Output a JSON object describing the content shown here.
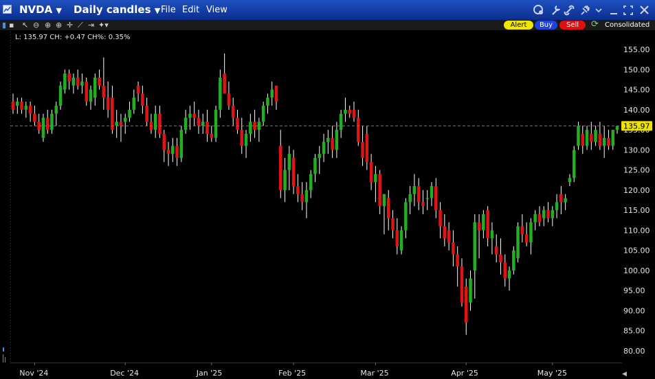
{
  "window": {
    "symbol": "NVDA",
    "chart_type": "Daily candles",
    "menus": [
      "File",
      "Edit",
      "View"
    ]
  },
  "toolbar": {
    "alert_label": "Alert",
    "buy_label": "Buy",
    "sell_label": "Sell",
    "route_label": "Consolidated",
    "colors": {
      "alert": "#f2e600",
      "buy": "#2244dd",
      "sell": "#e01010",
      "up": "#22b022",
      "down": "#e01414"
    }
  },
  "legend": {
    "text": "L: 135.97 CH: +0.47 CH%: 0.35%"
  },
  "chart_data": {
    "type": "candlestick",
    "title": "",
    "last_price": 135.97,
    "last_price_label": "135.97",
    "ylim": [
      77,
      158
    ],
    "y_ticks": [
      "80.00",
      "85.00",
      "90.00",
      "95.00",
      "100.00",
      "105.00",
      "110.00",
      "115.00",
      "120.00",
      "125.00",
      "130.00",
      "135.00",
      "140.00",
      "145.00",
      "150.00",
      "155.00"
    ],
    "x_labels": [
      {
        "label": "Nov '24",
        "index": 5
      },
      {
        "label": "Dec '24",
        "index": 26
      },
      {
        "label": "Jan '25",
        "index": 46
      },
      {
        "label": "Feb '25",
        "index": 65
      },
      {
        "label": "Mar '25",
        "index": 84
      },
      {
        "label": "Apr '25",
        "index": 105
      },
      {
        "label": "May '25",
        "index": 125
      }
    ],
    "candles": [
      {
        "o": 142,
        "h": 144,
        "l": 139,
        "c": 140
      },
      {
        "o": 141,
        "h": 143,
        "l": 139,
        "c": 142
      },
      {
        "o": 142,
        "h": 143,
        "l": 139,
        "c": 140
      },
      {
        "o": 140,
        "h": 142,
        "l": 138,
        "c": 141
      },
      {
        "o": 141,
        "h": 142,
        "l": 137,
        "c": 139
      },
      {
        "o": 139,
        "h": 141,
        "l": 136,
        "c": 137
      },
      {
        "o": 137,
        "h": 139,
        "l": 134,
        "c": 135
      },
      {
        "o": 133,
        "h": 139,
        "l": 132,
        "c": 138
      },
      {
        "o": 138,
        "h": 140,
        "l": 134,
        "c": 135
      },
      {
        "o": 135,
        "h": 140,
        "l": 134,
        "c": 139
      },
      {
        "o": 139,
        "h": 142,
        "l": 136,
        "c": 141
      },
      {
        "o": 141,
        "h": 147,
        "l": 140,
        "c": 146
      },
      {
        "o": 145,
        "h": 150,
        "l": 144,
        "c": 149
      },
      {
        "o": 149,
        "h": 150,
        "l": 145,
        "c": 147
      },
      {
        "o": 146,
        "h": 149,
        "l": 144,
        "c": 148
      },
      {
        "o": 148,
        "h": 150,
        "l": 145,
        "c": 146
      },
      {
        "o": 146,
        "h": 149,
        "l": 144,
        "c": 147
      },
      {
        "o": 147,
        "h": 148,
        "l": 141,
        "c": 142
      },
      {
        "o": 142,
        "h": 146,
        "l": 140,
        "c": 145
      },
      {
        "o": 143,
        "h": 149,
        "l": 141,
        "c": 148
      },
      {
        "o": 148,
        "h": 150,
        "l": 145,
        "c": 146
      },
      {
        "o": 146,
        "h": 153,
        "l": 140,
        "c": 143
      },
      {
        "o": 143,
        "h": 147,
        "l": 138,
        "c": 140
      },
      {
        "o": 143,
        "h": 146,
        "l": 134,
        "c": 135
      },
      {
        "o": 136,
        "h": 140,
        "l": 133,
        "c": 137
      },
      {
        "o": 137,
        "h": 139,
        "l": 132,
        "c": 136
      },
      {
        "o": 137,
        "h": 139,
        "l": 134,
        "c": 138
      },
      {
        "o": 138,
        "h": 142,
        "l": 137,
        "c": 140
      },
      {
        "o": 140,
        "h": 145,
        "l": 139,
        "c": 143
      },
      {
        "o": 146,
        "h": 147,
        "l": 142,
        "c": 144
      },
      {
        "o": 144,
        "h": 146,
        "l": 139,
        "c": 141
      },
      {
        "o": 141,
        "h": 143,
        "l": 136,
        "c": 137
      },
      {
        "o": 137,
        "h": 139,
        "l": 134,
        "c": 135
      },
      {
        "o": 135,
        "h": 141,
        "l": 133,
        "c": 139
      },
      {
        "o": 139,
        "h": 141,
        "l": 133,
        "c": 134
      },
      {
        "o": 134,
        "h": 135,
        "l": 127,
        "c": 130
      },
      {
        "o": 130,
        "h": 132,
        "l": 126,
        "c": 129
      },
      {
        "o": 129,
        "h": 133,
        "l": 127,
        "c": 131
      },
      {
        "o": 131,
        "h": 133,
        "l": 126,
        "c": 128
      },
      {
        "o": 128,
        "h": 136,
        "l": 127,
        "c": 135
      },
      {
        "o": 135,
        "h": 140,
        "l": 134,
        "c": 138
      },
      {
        "o": 138,
        "h": 141,
        "l": 135,
        "c": 139
      },
      {
        "o": 139,
        "h": 142,
        "l": 136,
        "c": 138
      },
      {
        "o": 138,
        "h": 140,
        "l": 134,
        "c": 136
      },
      {
        "o": 136,
        "h": 139,
        "l": 134,
        "c": 137
      },
      {
        "o": 137,
        "h": 140,
        "l": 132,
        "c": 134
      },
      {
        "o": 134,
        "h": 136,
        "l": 132,
        "c": 133
      },
      {
        "o": 133,
        "h": 141,
        "l": 132,
        "c": 140
      },
      {
        "o": 140,
        "h": 150,
        "l": 138,
        "c": 148
      },
      {
        "o": 149,
        "h": 154,
        "l": 144,
        "c": 144
      },
      {
        "o": 144,
        "h": 147,
        "l": 140,
        "c": 141
      },
      {
        "o": 141,
        "h": 143,
        "l": 136,
        "c": 138
      },
      {
        "o": 138,
        "h": 140,
        "l": 134,
        "c": 135
      },
      {
        "o": 135,
        "h": 138,
        "l": 129,
        "c": 131
      },
      {
        "o": 131,
        "h": 135,
        "l": 128,
        "c": 134
      },
      {
        "o": 134,
        "h": 139,
        "l": 132,
        "c": 137
      },
      {
        "o": 137,
        "h": 140,
        "l": 133,
        "c": 135
      },
      {
        "o": 135,
        "h": 138,
        "l": 132,
        "c": 137
      },
      {
        "o": 137,
        "h": 142,
        "l": 136,
        "c": 141
      },
      {
        "o": 141,
        "h": 144,
        "l": 139,
        "c": 143
      },
      {
        "o": 143,
        "h": 147,
        "l": 141,
        "c": 145
      },
      {
        "o": 146,
        "h": 146,
        "l": 140,
        "c": 142
      },
      {
        "o": 131,
        "h": 135,
        "l": 118,
        "c": 120
      },
      {
        "o": 120,
        "h": 128,
        "l": 117,
        "c": 125
      },
      {
        "o": 125,
        "h": 131,
        "l": 120,
        "c": 129
      },
      {
        "o": 128,
        "h": 130,
        "l": 119,
        "c": 121
      },
      {
        "o": 121,
        "h": 124,
        "l": 117,
        "c": 119
      },
      {
        "o": 119,
        "h": 122,
        "l": 115,
        "c": 117
      },
      {
        "o": 117,
        "h": 122,
        "l": 113,
        "c": 120
      },
      {
        "o": 120,
        "h": 125,
        "l": 118,
        "c": 124
      },
      {
        "o": 124,
        "h": 129,
        "l": 122,
        "c": 128
      },
      {
        "o": 128,
        "h": 131,
        "l": 124,
        "c": 129
      },
      {
        "o": 129,
        "h": 134,
        "l": 127,
        "c": 132
      },
      {
        "o": 132,
        "h": 135,
        "l": 129,
        "c": 133
      },
      {
        "o": 133,
        "h": 136,
        "l": 128,
        "c": 130
      },
      {
        "o": 130,
        "h": 137,
        "l": 128,
        "c": 135
      },
      {
        "o": 135,
        "h": 140,
        "l": 133,
        "c": 139
      },
      {
        "o": 139,
        "h": 143,
        "l": 137,
        "c": 140
      },
      {
        "o": 140,
        "h": 141,
        "l": 138,
        "c": 139
      },
      {
        "o": 140,
        "h": 142,
        "l": 137,
        "c": 138
      },
      {
        "o": 138,
        "h": 140,
        "l": 131,
        "c": 132
      },
      {
        "o": 132,
        "h": 136,
        "l": 126,
        "c": 128
      },
      {
        "o": 134,
        "h": 136,
        "l": 125,
        "c": 127
      },
      {
        "o": 127,
        "h": 129,
        "l": 120,
        "c": 122
      },
      {
        "o": 122,
        "h": 126,
        "l": 117,
        "c": 124
      },
      {
        "o": 124,
        "h": 125,
        "l": 114,
        "c": 116
      },
      {
        "o": 116,
        "h": 119,
        "l": 109,
        "c": 119
      },
      {
        "o": 118,
        "h": 120,
        "l": 110,
        "c": 113
      },
      {
        "o": 113,
        "h": 115,
        "l": 108,
        "c": 110
      },
      {
        "o": 110,
        "h": 113,
        "l": 104,
        "c": 106
      },
      {
        "o": 105,
        "h": 111,
        "l": 104,
        "c": 110
      },
      {
        "o": 110,
        "h": 118,
        "l": 108,
        "c": 117
      },
      {
        "o": 117,
        "h": 121,
        "l": 114,
        "c": 119
      },
      {
        "o": 119,
        "h": 124,
        "l": 116,
        "c": 121
      },
      {
        "o": 121,
        "h": 123,
        "l": 115,
        "c": 117
      },
      {
        "o": 117,
        "h": 120,
        "l": 114,
        "c": 116
      },
      {
        "o": 118,
        "h": 120,
        "l": 115,
        "c": 118
      },
      {
        "o": 118,
        "h": 122,
        "l": 116,
        "c": 121
      },
      {
        "o": 121,
        "h": 123,
        "l": 113,
        "c": 115
      },
      {
        "o": 115,
        "h": 117,
        "l": 108,
        "c": 111
      },
      {
        "o": 111,
        "h": 114,
        "l": 106,
        "c": 108
      },
      {
        "o": 110,
        "h": 112,
        "l": 105,
        "c": 107
      },
      {
        "o": 107,
        "h": 110,
        "l": 101,
        "c": 104
      },
      {
        "o": 104,
        "h": 106,
        "l": 96,
        "c": 101
      },
      {
        "o": 101,
        "h": 103,
        "l": 91,
        "c": 92
      },
      {
        "o": 96,
        "h": 98,
        "l": 84,
        "c": 87
      },
      {
        "o": 92,
        "h": 100,
        "l": 90,
        "c": 98
      },
      {
        "o": 100,
        "h": 114,
        "l": 93,
        "c": 112
      },
      {
        "o": 112,
        "h": 114,
        "l": 103,
        "c": 110
      },
      {
        "o": 110,
        "h": 115,
        "l": 108,
        "c": 114
      },
      {
        "o": 115,
        "h": 116,
        "l": 106,
        "c": 108
      },
      {
        "o": 108,
        "h": 112,
        "l": 104,
        "c": 110
      },
      {
        "o": 106,
        "h": 109,
        "l": 102,
        "c": 104
      },
      {
        "o": 104,
        "h": 108,
        "l": 99,
        "c": 102
      },
      {
        "o": 102,
        "h": 104,
        "l": 96,
        "c": 98
      },
      {
        "o": 98,
        "h": 101,
        "l": 95,
        "c": 100
      },
      {
        "o": 100,
        "h": 106,
        "l": 99,
        "c": 105
      },
      {
        "o": 103,
        "h": 112,
        "l": 102,
        "c": 111
      },
      {
        "o": 111,
        "h": 114,
        "l": 107,
        "c": 109
      },
      {
        "o": 109,
        "h": 112,
        "l": 106,
        "c": 107
      },
      {
        "o": 107,
        "h": 113,
        "l": 104,
        "c": 112
      },
      {
        "o": 112,
        "h": 115,
        "l": 110,
        "c": 114
      },
      {
        "o": 114,
        "h": 116,
        "l": 111,
        "c": 112
      },
      {
        "o": 113,
        "h": 116,
        "l": 111,
        "c": 115
      },
      {
        "o": 115,
        "h": 117,
        "l": 112,
        "c": 113
      },
      {
        "o": 113,
        "h": 116,
        "l": 111,
        "c": 115
      },
      {
        "o": 115,
        "h": 119,
        "l": 113,
        "c": 117
      },
      {
        "o": 119,
        "h": 121,
        "l": 114,
        "c": 117
      },
      {
        "o": 117,
        "h": 119,
        "l": 115,
        "c": 118
      },
      {
        "o": 122,
        "h": 124,
        "l": 121,
        "c": 123
      },
      {
        "o": 123,
        "h": 131,
        "l": 122,
        "c": 130
      },
      {
        "o": 131,
        "h": 137,
        "l": 130,
        "c": 136
      },
      {
        "o": 134,
        "h": 136,
        "l": 129,
        "c": 131
      },
      {
        "o": 131,
        "h": 136,
        "l": 130,
        "c": 135
      },
      {
        "o": 134,
        "h": 137,
        "l": 130,
        "c": 132
      },
      {
        "o": 132,
        "h": 136,
        "l": 131,
        "c": 135
      },
      {
        "o": 134,
        "h": 137,
        "l": 130,
        "c": 131
      },
      {
        "o": 131,
        "h": 136,
        "l": 128,
        "c": 133
      },
      {
        "o": 133,
        "h": 135,
        "l": 130,
        "c": 131
      },
      {
        "o": 131,
        "h": 135,
        "l": 130,
        "c": 135
      },
      {
        "o": 135,
        "h": 136,
        "l": 134,
        "c": 135.97
      }
    ]
  }
}
